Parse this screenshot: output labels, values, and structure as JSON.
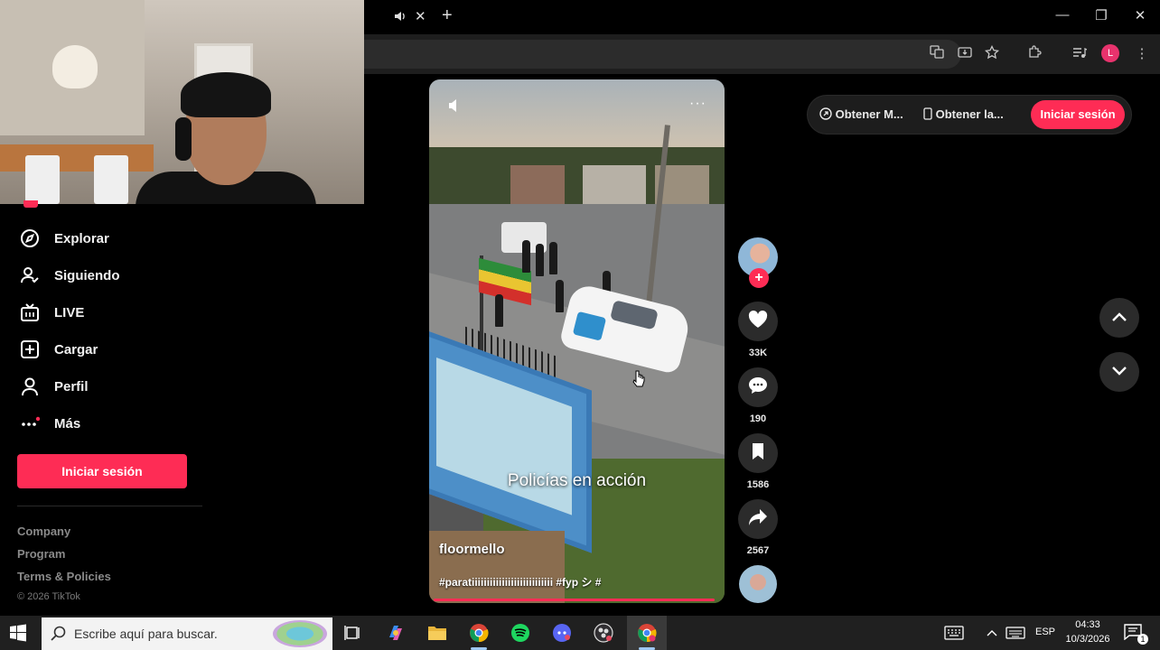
{
  "browser": {
    "tab_audio_icon": "speaker-icon",
    "tab_close_glyph": "✕",
    "new_tab_glyph": "+",
    "window_buttons": {
      "minimize": "—",
      "restore": "❐",
      "close": "✕"
    },
    "toolbar_icons": [
      "translate-icon",
      "install-icon",
      "star-icon",
      "extensions-icon",
      "media-icon"
    ],
    "profile_initial": "L",
    "profile_color": "#e8336d"
  },
  "sidebar": {
    "items": [
      {
        "label": "Explorar",
        "icon": "compass-icon"
      },
      {
        "label": "Siguiendo",
        "icon": "following-icon"
      },
      {
        "label": "LIVE",
        "icon": "live-tv-icon"
      },
      {
        "label": "Cargar",
        "icon": "upload-plus-icon"
      },
      {
        "label": "Perfil",
        "icon": "person-icon"
      },
      {
        "label": "Más",
        "icon": "more-dots-icon"
      }
    ],
    "login_label": "Iniciar sesión",
    "footer_links": [
      "Company",
      "Program",
      "Terms & Policies"
    ],
    "copyright": "© 2026 TikTok"
  },
  "video": {
    "caption": "Policías en acción",
    "author": "floormello",
    "tags": "#paratiiiiiiiiiiiiiiiiiiiiiiiiiii #fyp シ #",
    "mute_icon": "speaker-icon",
    "more_glyph": "···",
    "progress_fraction": 0.98
  },
  "actions": {
    "follow_glyph": "+",
    "likes": "33K",
    "comments": "190",
    "saves": "1586",
    "shares": "2567"
  },
  "topbar": {
    "get_app_label": "Obtener M...",
    "get_app2_label": "Obtener la...",
    "login_label": "Iniciar sesión"
  },
  "taskbar": {
    "search_placeholder": "Escribe aquí para buscar.",
    "language": "ESP",
    "time": "04:33",
    "date": "10/3/2026",
    "notification_count": "1"
  },
  "colors": {
    "accent": "#fe2c55",
    "background": "#000000"
  }
}
